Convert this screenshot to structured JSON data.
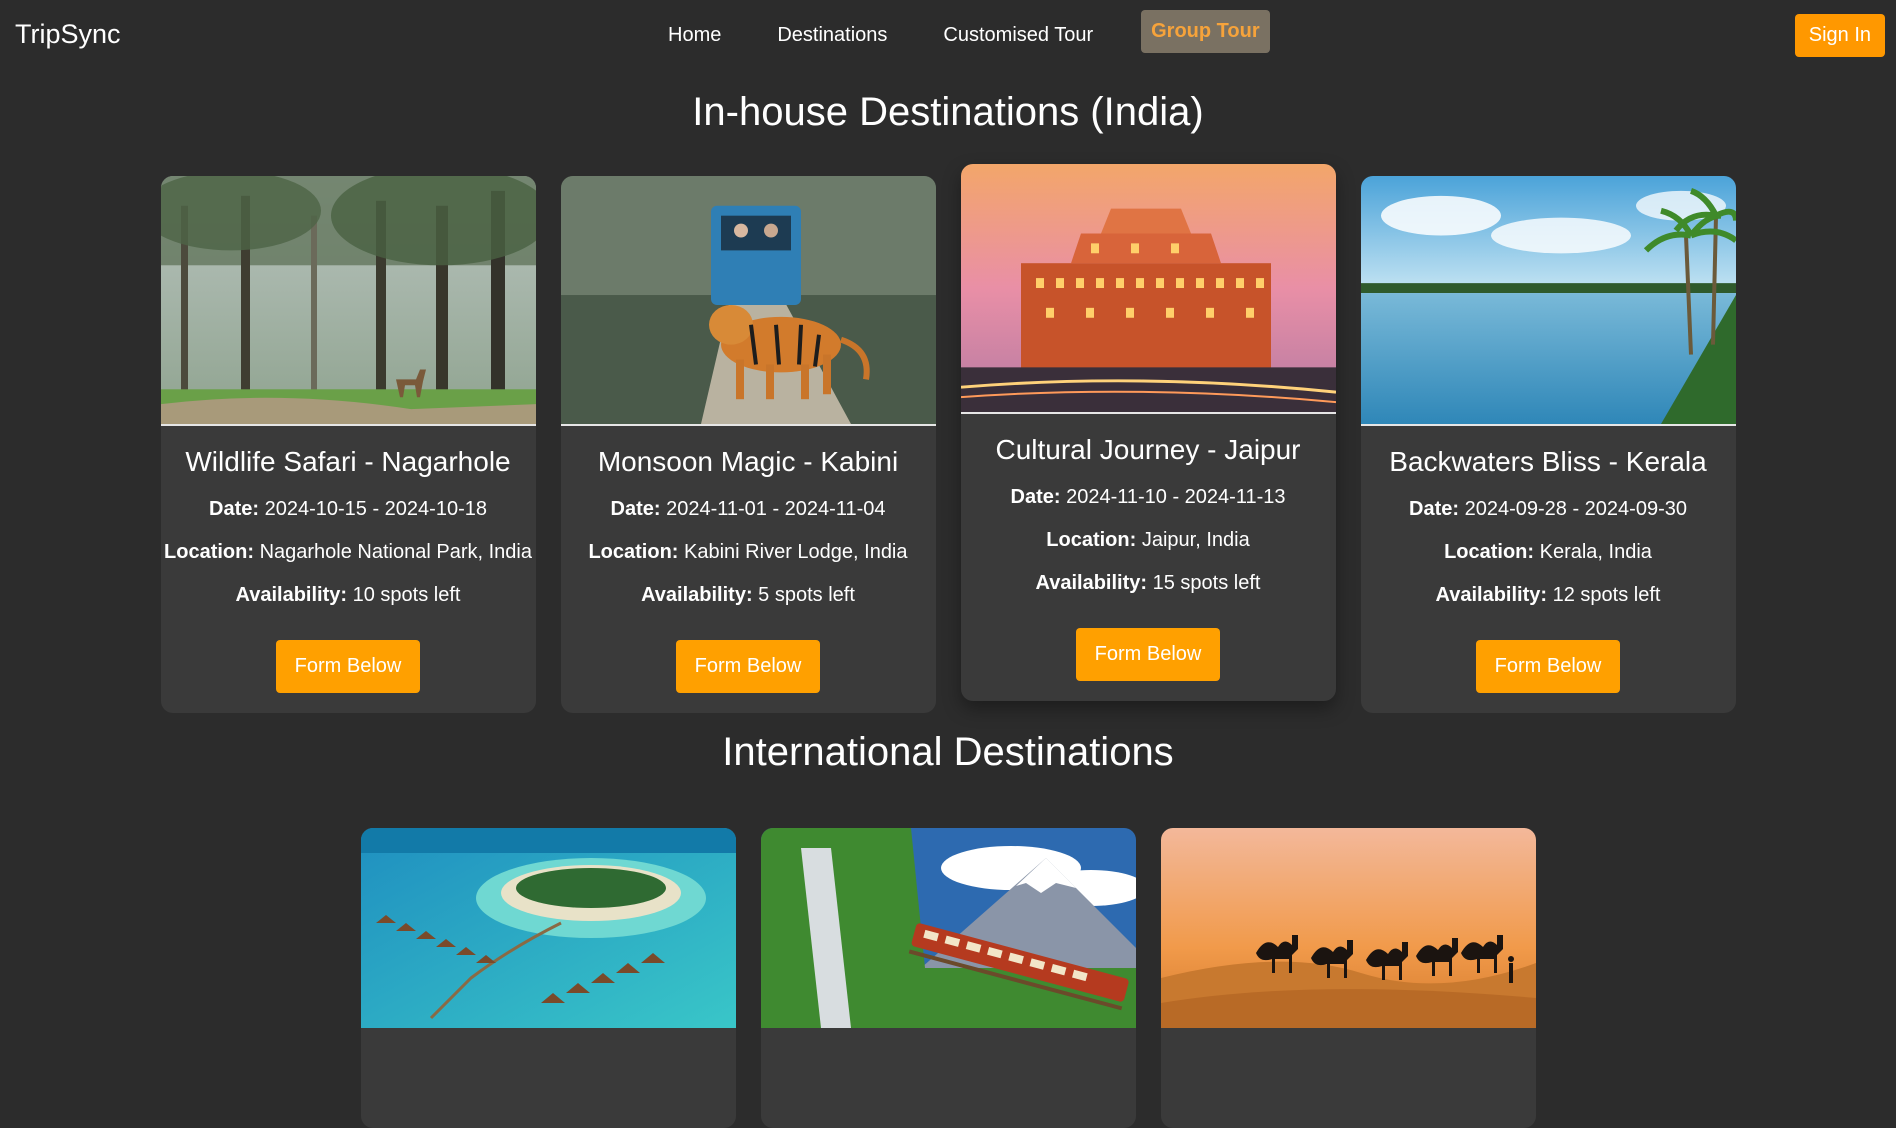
{
  "header": {
    "brand": "TripSync",
    "nav": [
      "Home",
      "Destinations",
      "Customised Tour",
      "Group Tour"
    ],
    "active": "Group Tour",
    "signin_label": "Sign In"
  },
  "sections": {
    "inhouse_title": "In-house Destinations (India)",
    "international_title": "International Destinations"
  },
  "labels": {
    "date": "Date:",
    "location": "Location:",
    "availability": "Availability:"
  },
  "inhouse": [
    {
      "title": "Wildlife Safari - Nagarhole",
      "date": " 2024-10-15 - 2024-10-18",
      "location": " Nagarhole National Park, India",
      "availability": " 10 spots left",
      "button": "Form Below",
      "image": "forest-deer-photo"
    },
    {
      "title": "Monsoon Magic - Kabini",
      "date": " 2024-11-01 - 2024-11-04",
      "location": " Kabini River Lodge, India",
      "availability": " 5 spots left",
      "button": "Form Below",
      "image": "tiger-safari-photo"
    },
    {
      "title": "Cultural Journey - Jaipur",
      "date": " 2024-11-10 - 2024-11-13",
      "location": " Jaipur, India",
      "availability": " 15 spots left",
      "button": "Form Below",
      "image": "hawa-mahal-photo"
    },
    {
      "title": "Backwaters Bliss - Kerala",
      "date": " 2024-09-28 - 2024-09-30",
      "location": " Kerala, India",
      "availability": " 12 spots left",
      "button": "Form Below",
      "image": "kerala-backwaters-photo"
    }
  ],
  "international": [
    {
      "image": "maldives-island-photo"
    },
    {
      "image": "swiss-alps-train-photo"
    },
    {
      "image": "desert-camels-photo"
    }
  ]
}
